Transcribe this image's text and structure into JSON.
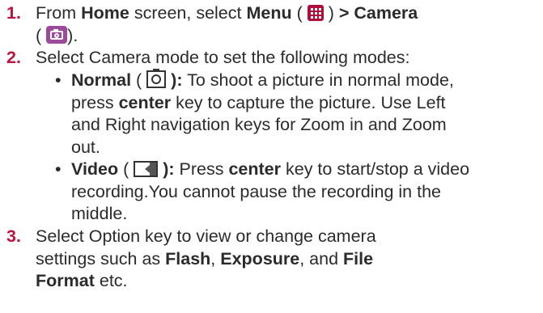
{
  "steps": [
    {
      "number": "1.",
      "lines": [
        {
          "t1": "From ",
          "home": "Home",
          "t2": " screen, select ",
          "menu": "Menu",
          "t3": " ( ",
          "t4": " ) ",
          "camera": "> Camera"
        },
        {
          "open": "(",
          "close": ")."
        }
      ]
    },
    {
      "number": "2.",
      "intro": "Select Camera mode to set the following modes:",
      "bullets": [
        {
          "dot": "•",
          "label": "Normal",
          "open": " ( ",
          "after_icon": " ):",
          "lines": [
            " To shoot a picture in normal mode,",
            "key to capture the picture. Use Left",
            "and Right navigation keys for Zoom in and Zoom",
            "out."
          ],
          "press": "press ",
          "center": "center",
          "after_center": " "
        },
        {
          "dot": "•",
          "label": "Video",
          "open": " ( ",
          "after_icon": " ):",
          "pre": " Press ",
          "center": "center",
          "post": " key to start/stop a video",
          "lines": [
            "recording.You cannot pause the recording in the",
            "middle."
          ]
        }
      ]
    },
    {
      "number": "3.",
      "lines": [
        "Select Option key to view or change camera",
        "settings such as ",
        ", ",
        ", and ",
        "etc."
      ],
      "flash": "Flash",
      "exposure": "Exposure",
      "file": "File",
      "format": "Format"
    }
  ],
  "icons": {
    "menu": "grid-menu-icon",
    "camera": "camera-app-icon",
    "normal": "camera-normal-mode-icon",
    "video": "video-mode-icon"
  },
  "colors": {
    "step_number": "#c0123c",
    "text": "#2b2b2b",
    "menu_icon": "#b00e3a",
    "camera_icon": "#9b4b9a"
  }
}
